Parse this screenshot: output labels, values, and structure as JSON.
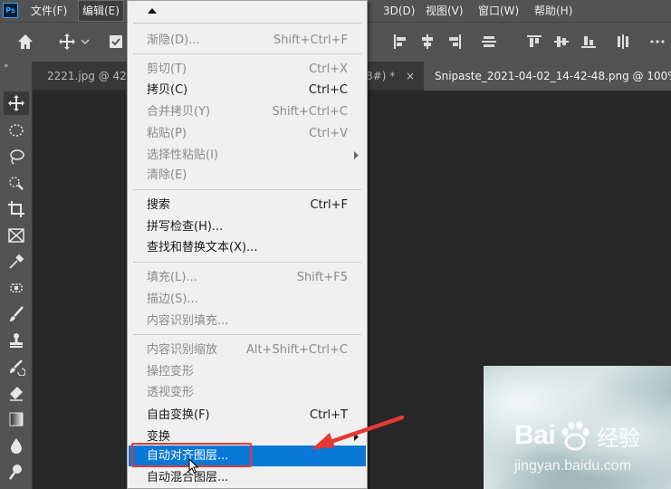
{
  "menubar": {
    "logo": "Ps",
    "items": [
      {
        "label": "文件(F)"
      },
      {
        "label": "编辑(E)"
      },
      {
        "label": "3D(D)"
      },
      {
        "label": "视图(V)"
      },
      {
        "label": "窗口(W)"
      },
      {
        "label": "帮助(H)"
      }
    ]
  },
  "tabs": [
    {
      "label": "2221.jpg @ 42",
      "active": false
    },
    {
      "label": "/8#) *",
      "active": false
    },
    {
      "label": "Snipaste_2021-04-02_14-42-48.png @ 100%",
      "active": true
    }
  ],
  "tab_close_glyph": "×",
  "toolbar_collapse_glyph": "»",
  "edit_menu": {
    "items": [
      {
        "label": "渐隐(D)...",
        "shortcut": "Shift+Ctrl+F",
        "enabled": false
      },
      {
        "label": "剪切(T)",
        "shortcut": "Ctrl+X",
        "enabled": false
      },
      {
        "label": "拷贝(C)",
        "shortcut": "Ctrl+C",
        "enabled": true
      },
      {
        "label": "合并拷贝(Y)",
        "shortcut": "Shift+Ctrl+C",
        "enabled": false
      },
      {
        "label": "粘贴(P)",
        "shortcut": "Ctrl+V",
        "enabled": false
      },
      {
        "label": "选择性粘贴(I)",
        "shortcut": "",
        "enabled": false,
        "submenu": true
      },
      {
        "label": "清除(E)",
        "shortcut": "",
        "enabled": false
      },
      {
        "label": "搜索",
        "shortcut": "Ctrl+F",
        "enabled": true
      },
      {
        "label": "拼写检查(H)...",
        "shortcut": "",
        "enabled": true
      },
      {
        "label": "查找和替换文本(X)...",
        "shortcut": "",
        "enabled": true
      },
      {
        "label": "填充(L)...",
        "shortcut": "Shift+F5",
        "enabled": false
      },
      {
        "label": "描边(S)...",
        "shortcut": "",
        "enabled": false
      },
      {
        "label": "内容识别填充...",
        "shortcut": "",
        "enabled": false
      },
      {
        "label": "内容识别缩放",
        "shortcut": "Alt+Shift+Ctrl+C",
        "enabled": false
      },
      {
        "label": "操控变形",
        "shortcut": "",
        "enabled": false
      },
      {
        "label": "透视变形",
        "shortcut": "",
        "enabled": false
      },
      {
        "label": "自由变换(F)",
        "shortcut": "Ctrl+T",
        "enabled": true
      },
      {
        "label": "变换",
        "shortcut": "",
        "enabled": true,
        "submenu": true
      },
      {
        "label": "自动对齐图层...",
        "shortcut": "",
        "enabled": true,
        "highlighted": true
      },
      {
        "label": "自动混合图层...",
        "shortcut": "",
        "enabled": true
      }
    ]
  },
  "watermark": {
    "logo_text": "Bai",
    "logo_text_cn": "经验",
    "url": "jingyan.baidu.com"
  },
  "colors": {
    "highlight": "#0a78d7",
    "annotation": "#e53935",
    "app_bg": "#535353"
  }
}
